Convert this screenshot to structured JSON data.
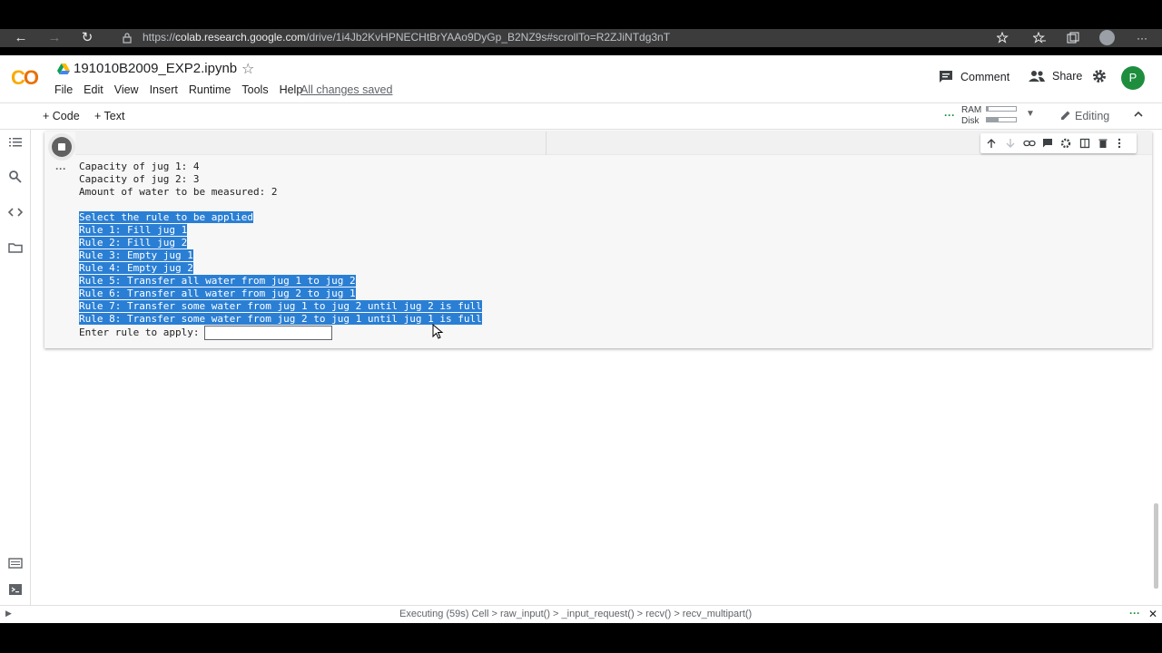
{
  "browser": {
    "url_prefix": "https://",
    "url_host": "colab.research.google.com",
    "url_path": "/drive/1i4Jb2KvHPNECHtBrYAAo9DyGp_B2NZ9s#scrollTo=R2ZJiNTdg3nT",
    "back_icon": "←",
    "forward_icon": "→",
    "reload_icon": "↻",
    "more_icon": "···"
  },
  "header": {
    "logo_c": "C",
    "logo_o": "O",
    "title": "191010B2009_EXP2.ipynb",
    "star": "☆",
    "menu": [
      "File",
      "Edit",
      "View",
      "Insert",
      "Runtime",
      "Tools",
      "Help"
    ],
    "saved_status": "All changes saved",
    "comment_label": "Comment",
    "share_label": "Share",
    "avatar_letter": "P"
  },
  "toolbar": {
    "add_code": "+ Code",
    "add_text": "+ Text",
    "ram_label": "RAM",
    "disk_label": "Disk",
    "ram_fraction": 0.05,
    "disk_fraction": 0.4,
    "editing_label": "Editing"
  },
  "cell": {
    "output_lines": [
      "Capacity of jug 1: 4",
      "Capacity of jug 2: 3",
      "Amount of water to be measured: 2",
      ""
    ],
    "selected_lines": [
      "Select the rule to be applied",
      "Rule 1: Fill jug 1",
      "Rule 2: Fill jug 2",
      "Rule 3: Empty jug 1",
      "Rule 4: Empty jug 2",
      "Rule 5: Transfer all water from jug 1 to jug 2",
      "Rule 6: Transfer all water from jug 2 to jug 1",
      "Rule 7: Transfer some water from jug 1 to jug 2 until jug 2 is full",
      "Rule 8: Transfer some water from jug 2 to jug 1 until jug 1 is full"
    ],
    "input_prompt": "Enter rule to apply:",
    "input_value": ""
  },
  "statusbar": {
    "text": "Executing (59s)  Cell > raw_input() > _input_request() > recv() > recv_multipart()"
  },
  "colors": {
    "selection": "#2a7fd4",
    "avatar": "#1e8e3e",
    "logo_primary": "#f9ab00",
    "logo_secondary": "#e8710a"
  }
}
